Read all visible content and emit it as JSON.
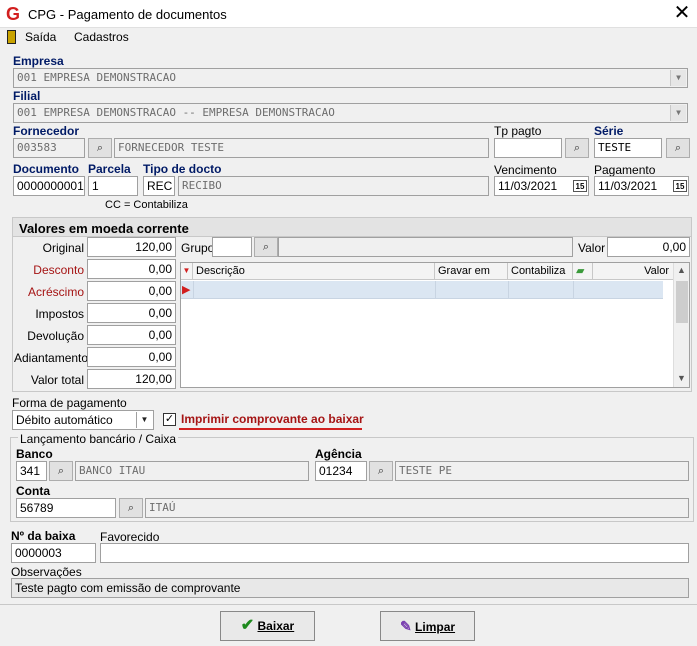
{
  "window": {
    "title": "CPG - Pagamento de documentos",
    "logo": "G"
  },
  "menu": {
    "items": [
      "Saída",
      "Cadastros"
    ]
  },
  "empresa": {
    "label": "Empresa",
    "value": "001 EMPRESA DEMONSTRACAO"
  },
  "filial": {
    "label": "Filial",
    "value": "001 EMPRESA DEMONSTRACAO -- EMPRESA DEMONSTRACAO"
  },
  "fornecedor": {
    "label": "Fornecedor",
    "code": "003583",
    "name": "FORNECEDOR TESTE"
  },
  "tp_pagto": {
    "label": "Tp pagto",
    "value": ""
  },
  "serie": {
    "label": "Série",
    "value": "TESTE"
  },
  "documento": {
    "label": "Documento",
    "value": "0000000001"
  },
  "parcela": {
    "label": "Parcela",
    "value": "1"
  },
  "tipo_docto": {
    "label": "Tipo de docto",
    "code": "REC",
    "name": "RECIBO"
  },
  "vencimento": {
    "label": "Vencimento",
    "value": "11/03/2021"
  },
  "pagamento": {
    "label": "Pagamento",
    "value": "11/03/2021"
  },
  "cc_note": "CC = Contabiliza",
  "valores": {
    "title": "Valores em moeda corrente",
    "fields": [
      {
        "label": "Original",
        "value": "120,00",
        "red": false
      },
      {
        "label": "Desconto",
        "value": "0,00",
        "red": true
      },
      {
        "label": "Acréscimo",
        "value": "0,00",
        "red": true
      },
      {
        "label": "Impostos",
        "value": "0,00",
        "red": false
      },
      {
        "label": "Devolução",
        "value": "0,00",
        "red": false
      },
      {
        "label": "Adiantamento",
        "value": "0,00",
        "red": false
      },
      {
        "label": "Valor total",
        "value": "120,00",
        "red": false
      }
    ],
    "grupo": {
      "label": "Grupo",
      "code": "",
      "name": ""
    },
    "valor": {
      "label": "Valor",
      "value": "0,00"
    },
    "grid_columns": [
      "Descrição",
      "Gravar em",
      "Contabiliza",
      "Valor"
    ]
  },
  "forma_pagamento": {
    "label": "Forma de pagamento",
    "value": "Débito automático"
  },
  "imprimir": {
    "label": "Imprimir comprovante ao baixar",
    "checked": true
  },
  "lancamento": {
    "title": "Lançamento bancário / Caixa",
    "banco": {
      "label": "Banco",
      "code": "341",
      "name": "BANCO ITAU"
    },
    "agencia": {
      "label": "Agência",
      "code": "01234",
      "name": "TESTE PE"
    },
    "conta": {
      "label": "Conta",
      "code": "56789",
      "name": "ITAÚ"
    }
  },
  "baixa": {
    "label": "Nº da baixa",
    "value": "0000003"
  },
  "favorecido": {
    "label": "Favorecido",
    "value": ""
  },
  "observacoes": {
    "label": "Observações",
    "value": "Teste pagto com emissão de comprovante"
  },
  "buttons": {
    "baixar": "Baixar",
    "limpar": "Limpar"
  },
  "colors": {
    "label_blue": "#001a66",
    "label_red": "#a51414",
    "accent_red": "#d21f1f"
  }
}
